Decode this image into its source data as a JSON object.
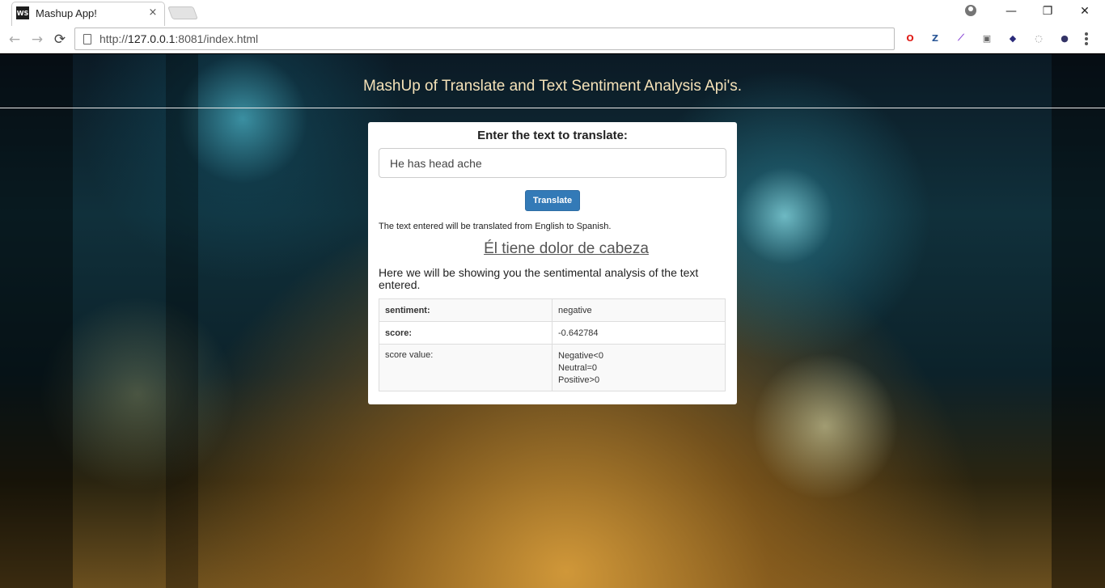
{
  "browser": {
    "tab_title": "Mashup App!",
    "favicon_text": "WS",
    "tab_close": "×",
    "url_prefix": "http://",
    "url_host": "127.0.0.1",
    "url_rest": ":8081/index.html",
    "back": "←",
    "forward": "→",
    "reload": "⟳",
    "window_controls": {
      "minimize": "—",
      "restore": "❐",
      "close": "✕"
    },
    "extensions": [
      {
        "name": "opera-icon",
        "glyph": "O",
        "color": "#e0201b"
      },
      {
        "name": "zotero-icon",
        "glyph": "Z",
        "color": "#2b5797"
      },
      {
        "name": "pen-icon",
        "glyph": "⟋",
        "color": "#8a47d6"
      },
      {
        "name": "extension-box-icon",
        "glyph": "▣",
        "color": "#666666"
      },
      {
        "name": "wappalyzer-icon",
        "glyph": "◆",
        "color": "#2a2a7a"
      },
      {
        "name": "circle-ext-icon",
        "glyph": "◌",
        "color": "#888888"
      },
      {
        "name": "ghost-ext-icon",
        "glyph": "●",
        "color": "#333366"
      }
    ]
  },
  "page": {
    "header": "MashUp of Translate and Text Sentiment Analysis Api's.",
    "form_title": "Enter the text to translate:",
    "input_value": "He has head ache",
    "translate_button": "Translate",
    "note": "The text entered will be translated from English to Spanish.",
    "translation": "Él tiene dolor de cabeza",
    "description": "Here we will be showing you the sentimental analysis of the text entered.",
    "table": {
      "rows": [
        {
          "key": "sentiment:",
          "value": "negative"
        },
        {
          "key": "score:",
          "value": "-0.642784"
        },
        {
          "key": "score value:",
          "value_lines": [
            "Negative<0",
            "Neutral=0",
            "Positive>0"
          ]
        }
      ]
    }
  }
}
